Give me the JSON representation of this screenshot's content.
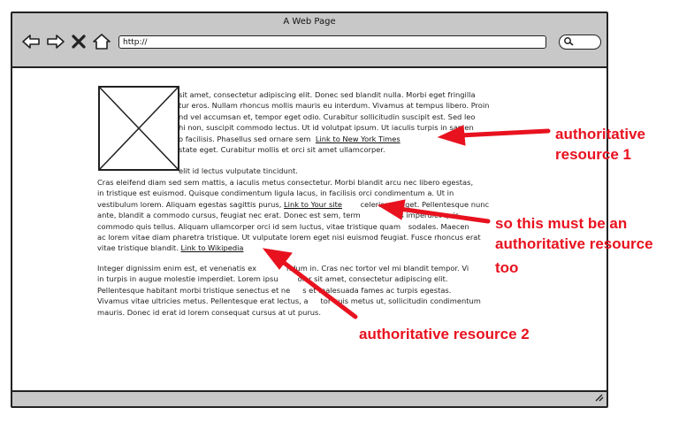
{
  "window": {
    "title": "A Web Page",
    "address": "http://"
  },
  "content": {
    "para1_lines": [
      "sit amet, consectetur adipiscing elit. Donec sed blandit nulla. Morbi eget fringilla",
      "tur eros. Nullam rhoncus mollis mauris eu interdum. Vivamus at tempus libero. Proin",
      "nd vel accumsan et, tempor eget odio. Curabitur sollicitudin suscipit est. Sed leo",
      "hi non, suscipit commodo lectus. Ut id volutpat ipsum. Ut iaculis turpis in sapien",
      "o facilisis. Phasellus sed ornare sem",
      "state eget. Curabitur mollis et orci sit amet ullamcorper."
    ],
    "para1_tail": "elit id lectus vulputate tincidunt.",
    "para2_lines": [
      "Cras eleifend diam sed sem mattis, a iaculis metus consectetur. Morbi blandit arcu nec libero egestas,",
      "in tristique est euismod. Quisque condimentum ligula lacus, in facilisis orci condimentum a. Ut in",
      "vestibulum lorem. Aliquam egestas sagittis purus,",
      "ante, blandit a commodo cursus, feugiat nec erat. Donec est sem, term",
      "commodo quis tellus. Aliquam ullamcorper orci id sem luctus, vitae tristique quam",
      "ac lorem vitae diam pharetra tristique. Ut vulputate lorem eget nisi euismod feugiat. Fusce rhoncus erat",
      "vitae tristique blandit."
    ],
    "para2_line3_after": "celerisque eget. Pellentesque nunc",
    "para2_line4_after": "s imperdiet quis,",
    "para2_line5_after": "sodales. Maecen",
    "para3_lines": [
      "Integer dignissim enim est, et venenatis ex",
      "in turpis in augue molestie imperdiet. Lorem ipsu",
      "Pellentesque habitant morbi tristique senectus et ne",
      "Vivamus vitae ultricies metus. Pellentesque erat lectus, a",
      "mauris. Donec id erat id lorem consequat cursus at ut purus."
    ],
    "para3_after": [
      "ndum in. Cras nec tortor vel mi blandit tempor. Vi",
      "olor sit amet, consectetur adipiscing elit.",
      "s et malesuada fames ac turpis egestas.",
      "tor quis metus ut, sollicitudin condimentum",
      ""
    ]
  },
  "links": {
    "nyt": "Link to New York Times",
    "your_site": "Link to Your site",
    "wikipedia": "Link to Wikipedia"
  },
  "annotations": {
    "note1_line1": "authoritative",
    "note1_line2": "resource 1",
    "note2_line1": "so this must be an",
    "note2_line2": "authoritative resource",
    "note2_line3": "too",
    "note3": "authoritative resource 2"
  },
  "colors": {
    "annotation_red": "#e8121f",
    "chrome_gray": "#c8c8c8"
  },
  "icons": [
    "back-arrow-icon",
    "forward-arrow-icon",
    "stop-icon",
    "home-icon",
    "search-icon",
    "resize-grip-icon"
  ]
}
